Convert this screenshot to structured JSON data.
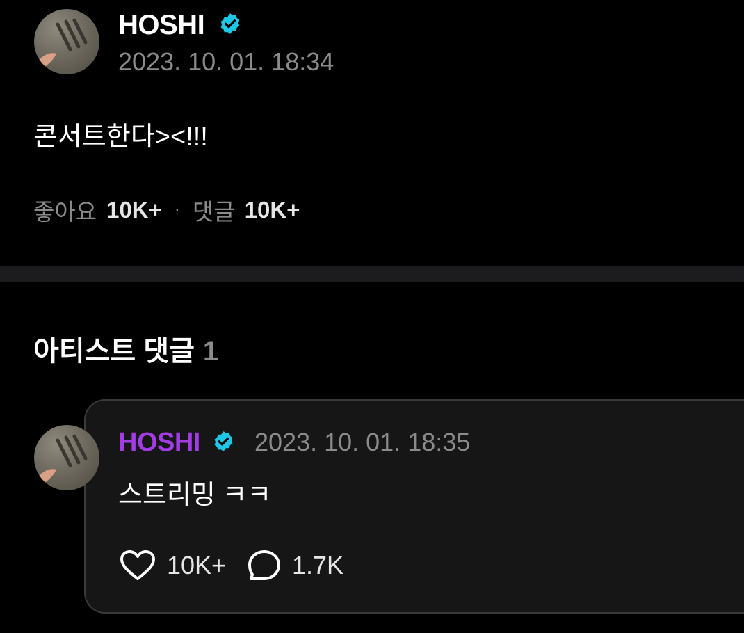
{
  "post": {
    "author": "HOSHI",
    "timestamp": "2023. 10. 01. 18:34",
    "text": "콘서트한다><!!!",
    "likes_label": "좋아요",
    "likes_count": "10K+",
    "separator": "·",
    "comments_label": "댓글",
    "comments_count": "10K+"
  },
  "artist_comments": {
    "title": "아티스트 댓글",
    "count": "1",
    "items": [
      {
        "author": "HOSHI",
        "timestamp": "2023. 10. 01. 18:35",
        "text": "스트리밍 ㅋㅋ",
        "likes_count": "10K+",
        "replies_count": "1.7K"
      }
    ]
  },
  "icons": {
    "verified": "verified-badge-icon",
    "like": "heart-icon",
    "reply": "comment-bubble-icon"
  },
  "colors": {
    "background": "#000000",
    "verified": "#1fc7e6",
    "comment_author": "#a43ce6",
    "muted_text": "#8b8b8b",
    "card_bg": "#161616"
  }
}
